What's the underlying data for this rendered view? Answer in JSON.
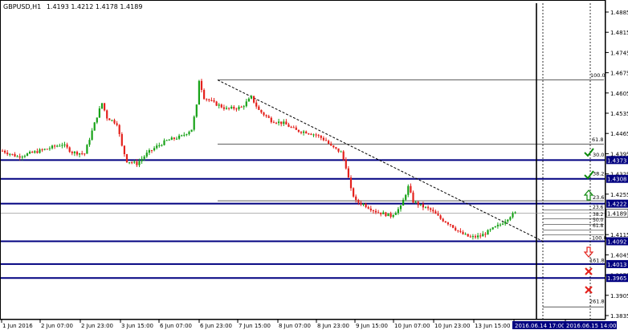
{
  "header": {
    "symbol": "GBPUSD,H1",
    "ohlc": "1.4193 1.4212 1.4178 1.4189"
  },
  "colors": {
    "up": "#17a217",
    "down": "#e4211c",
    "level_line": "#000080",
    "label_bg": "#000080",
    "axis": "#000000",
    "grid": "#000000",
    "check": "#0c8a0c",
    "cross": "#e4211c"
  },
  "chart_data": {
    "type": "candlestick",
    "title": "GBPUSD,H1",
    "ylim": [
      1.3835,
      1.4925
    ],
    "x_tick_labels": [
      "1 Jun 2016",
      "2 Jun 07:00",
      "2 Jun 23:00",
      "3 Jun 15:00",
      "6 Jun 07:00",
      "6 Jun 23:00",
      "7 Jun 15:00",
      "8 Jun 07:00",
      "8 Jun 23:00",
      "9 Jun 15:00",
      "10 Jun 07:00",
      "10 Jun 23:00",
      "13 Jun 15:00",
      "2016.06.14 17:00",
      "2016.06.15 14:00"
    ],
    "y_tick_labels": [
      "1.4885",
      "1.4815",
      "1.4745",
      "1.4675",
      "1.4605",
      "1.4535",
      "1.4465",
      "1.4395",
      "1.4325",
      "1.4255",
      "1.4185",
      "1.4115",
      "1.4045",
      "1.3975",
      "1.3905",
      "1.3835"
    ],
    "current_price": "1.4189",
    "horizontal_levels": [
      "1.4373",
      "1.4308",
      "1.4222",
      "1.4092",
      "1.4013",
      "1.3965"
    ],
    "fib_labels_large": [
      "100.0",
      "61.8",
      "30.0",
      "38.2",
      "23.6",
      "100.0",
      "161.8",
      "261.8"
    ],
    "fib_labels_small": [
      "23.6",
      "38.2",
      "50.0",
      "61.8"
    ],
    "price_path": [
      [
        0,
        1.4405
      ],
      [
        6,
        1.4385
      ],
      [
        12,
        1.4398
      ],
      [
        18,
        1.4412
      ],
      [
        24,
        1.4428
      ],
      [
        28,
        1.44
      ],
      [
        33,
        1.4395
      ],
      [
        38,
        1.4525
      ],
      [
        40,
        1.457
      ],
      [
        42,
        1.452
      ],
      [
        46,
        1.45
      ],
      [
        48,
        1.442
      ],
      [
        50,
        1.437
      ],
      [
        54,
        1.436
      ],
      [
        58,
        1.4395
      ],
      [
        62,
        1.442
      ],
      [
        66,
        1.444
      ],
      [
        72,
        1.4455
      ],
      [
        76,
        1.448
      ],
      [
        78,
        1.456
      ],
      [
        79,
        1.465
      ],
      [
        81,
        1.459
      ],
      [
        85,
        1.457
      ],
      [
        90,
        1.455
      ],
      [
        96,
        1.4555
      ],
      [
        100,
        1.459
      ],
      [
        103,
        1.4545
      ],
      [
        108,
        1.451
      ],
      [
        113,
        1.45
      ],
      [
        118,
        1.4475
      ],
      [
        122,
        1.447
      ],
      [
        126,
        1.446
      ],
      [
        130,
        1.444
      ],
      [
        132,
        1.442
      ],
      [
        136,
        1.44
      ],
      [
        138,
        1.435
      ],
      [
        140,
        1.427
      ],
      [
        142,
        1.423
      ],
      [
        145,
        1.422
      ],
      [
        150,
        1.4195
      ],
      [
        156,
        1.418
      ],
      [
        160,
        1.421
      ],
      [
        163,
        1.428
      ],
      [
        165,
        1.423
      ],
      [
        168,
        1.4215
      ],
      [
        172,
        1.42
      ],
      [
        176,
        1.417
      ],
      [
        180,
        1.415
      ],
      [
        184,
        1.412
      ],
      [
        188,
        1.4105
      ],
      [
        192,
        1.411
      ],
      [
        196,
        1.413
      ],
      [
        200,
        1.415
      ],
      [
        204,
        1.418
      ],
      [
        206,
        1.4189
      ]
    ]
  }
}
